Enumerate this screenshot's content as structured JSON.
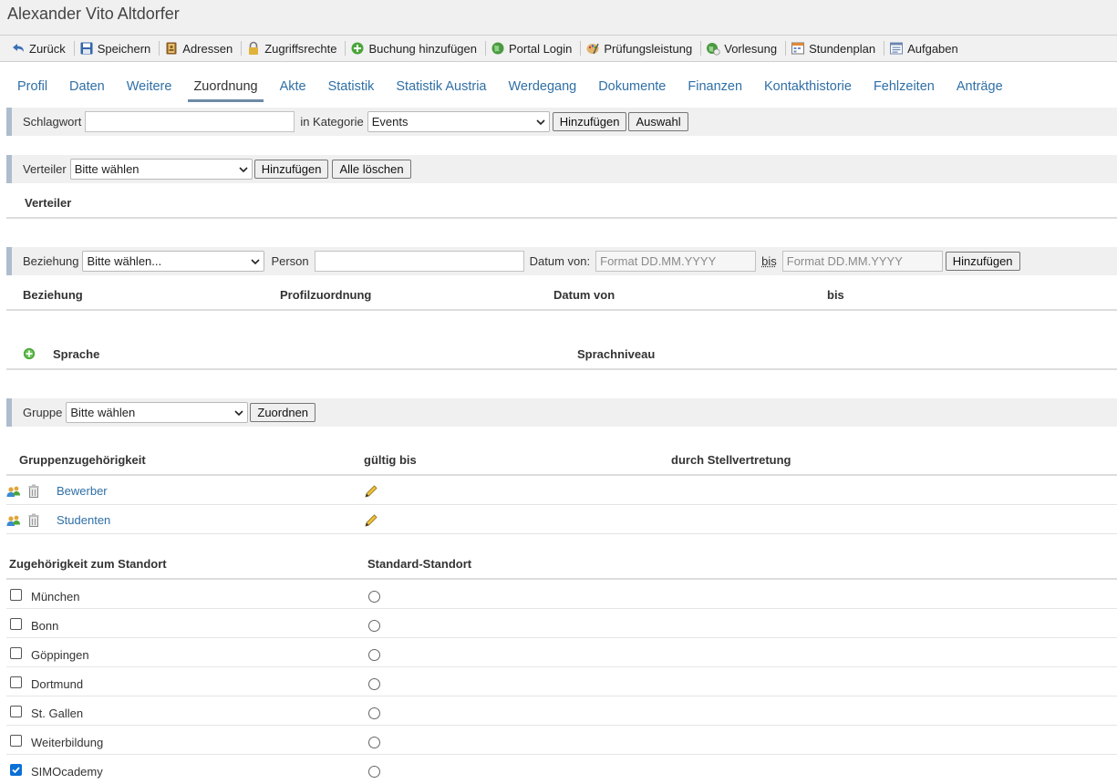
{
  "window": {
    "title": "Alexander Vito Altdorfer"
  },
  "toolbar": [
    {
      "label": "Zurück",
      "icon": "back-arrow-icon"
    },
    {
      "label": "Speichern",
      "icon": "save-icon"
    },
    {
      "label": "Adressen",
      "icon": "address-book-icon"
    },
    {
      "label": "Zugriffsrechte",
      "icon": "lock-icon"
    },
    {
      "label": "Buchung hinzufügen",
      "icon": "add-circle-icon"
    },
    {
      "label": "Portal Login",
      "icon": "globe-icon"
    },
    {
      "label": "Prüfungsleistung",
      "icon": "palette-icon"
    },
    {
      "label": "Vorlesung",
      "icon": "lecture-globe-icon"
    },
    {
      "label": "Stundenplan",
      "icon": "timetable-icon"
    },
    {
      "label": "Aufgaben",
      "icon": "tasks-list-icon"
    }
  ],
  "tabs": [
    "Profil",
    "Daten",
    "Weitere",
    "Zuordnung",
    "Akte",
    "Statistik",
    "Statistik Austria",
    "Werdegang",
    "Dokumente",
    "Finanzen",
    "Kontakthistorie",
    "Fehlzeiten",
    "Anträge"
  ],
  "active_tab": "Zuordnung",
  "schlagwort": {
    "label": "Schlagwort",
    "value": "",
    "category_label": "in Kategorie",
    "category_value": "Events",
    "add_button": "Hinzufügen",
    "select_button": "Auswahl"
  },
  "verteiler": {
    "label": "Verteiler",
    "select_value": "Bitte wählen",
    "add_button": "Hinzufügen",
    "clear_button": "Alle löschen",
    "table_header": "Verteiler"
  },
  "beziehung": {
    "label": "Beziehung",
    "select_value": "Bitte wählen...",
    "person_label": "Person",
    "person_value": "",
    "date_from_label": "Datum von:",
    "date_from_placeholder": "Format DD.MM.YYYY",
    "date_to_label": "bis",
    "date_to_placeholder": "Format DD.MM.YYYY",
    "add_button": "Hinzufügen",
    "columns": [
      "Beziehung",
      "Profilzuordnung",
      "Datum von",
      "bis"
    ]
  },
  "sprache": {
    "columns": [
      "Sprache",
      "Sprachniveau"
    ]
  },
  "gruppe": {
    "label": "Gruppe",
    "select_value": "Bitte wählen",
    "assign_button": "Zuordnen",
    "columns": [
      "Gruppenzugehörigkeit",
      "gültig bis",
      "durch Stellvertretung"
    ],
    "rows": [
      {
        "name": "Bewerber"
      },
      {
        "name": "Studenten"
      }
    ]
  },
  "standort": {
    "columns": [
      "Zugehörigkeit zum Standort",
      "Standard-Standort"
    ],
    "rows": [
      {
        "name": "München",
        "checked": false
      },
      {
        "name": "Bonn",
        "checked": false
      },
      {
        "name": "Göppingen",
        "checked": false
      },
      {
        "name": "Dortmund",
        "checked": false
      },
      {
        "name": "St. Gallen",
        "checked": false
      },
      {
        "name": "Weiterbildung",
        "checked": false
      },
      {
        "name": "SIMOcademy",
        "checked": true
      }
    ]
  },
  "colors": {
    "link": "#2f6fa6",
    "accent_bar": "#aebdcd",
    "checkbox_on": "#0b6fd6"
  }
}
